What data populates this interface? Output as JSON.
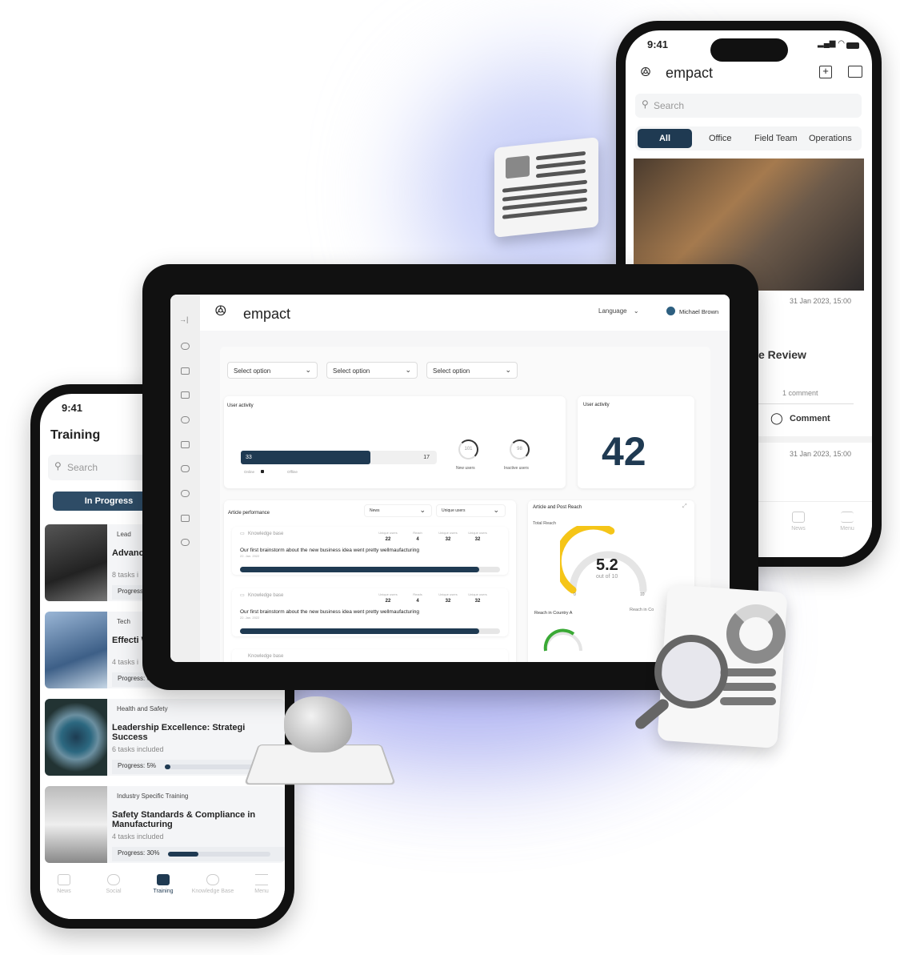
{
  "right_phone": {
    "time": "9:41",
    "brand": "empact",
    "search_placeholder": "Search",
    "tabs": [
      "All",
      "Office",
      "Field Team",
      "Operations"
    ],
    "post1_date": "31 Jan 2023, 15:00",
    "post1_title": "e Review",
    "post1_comments": "1 comment",
    "comment_label": "Comment",
    "post2_date": "31 Jan 2023, 15:00",
    "nav": [
      "News",
      "Menu"
    ]
  },
  "tablet": {
    "brand": "empact",
    "language_label": "Language",
    "user_name": "Michael Brown",
    "filters": [
      "Select option",
      "Select option",
      "Select option"
    ],
    "user_activity": {
      "title": "User activity",
      "online": 33,
      "offline": 17,
      "online_label": "Online",
      "offline_label": "Offline",
      "new_users": 101,
      "new_users_label": "New users",
      "inactive_users": 98,
      "inactive_users_label": "Inactive users"
    },
    "user_activity_total": {
      "title": "User activity",
      "value": "42"
    },
    "article_performance": {
      "title": "Article performance",
      "filter1": "News",
      "filter2": "Unique users",
      "items": [
        {
          "category": "Knowledge base",
          "title": "Our first brainstorm about the new business idea went pretty wellmaufacturing",
          "date": "22. Jan. 2022",
          "stats": [
            {
              "label": "Unique users",
              "value": "22"
            },
            {
              "label": "Reach",
              "value": "4"
            },
            {
              "label": "Unique users",
              "value": "32"
            },
            {
              "label": "Unique users",
              "value": "32"
            }
          ],
          "progress": 0.92
        },
        {
          "category": "Knowledge base",
          "title": "Our first brainstorm about the new business idea went pretty wellmaufacturing",
          "date": "22. Jan. 2022",
          "stats": [
            {
              "label": "Unique users",
              "value": "22"
            },
            {
              "label": "Reads",
              "value": "4"
            },
            {
              "label": "Unique users",
              "value": "32"
            },
            {
              "label": "Unique users",
              "value": "32"
            }
          ],
          "progress": 0.92
        },
        {
          "category": "Knowledge base"
        }
      ]
    },
    "reach": {
      "title": "Article and Post Reach",
      "total_label": "Total Reach",
      "value": "5.2",
      "out_of": "out of 10",
      "min": "0",
      "max": "10",
      "fraction": 0.52,
      "country_a_label": "Reach in Country A",
      "country_b_label": "Reach in Co",
      "gauge_color": "#f5c518",
      "country_a_color": "#3aa935"
    }
  },
  "left_phone": {
    "time": "9:41",
    "title": "Training",
    "search_placeholder": "Search",
    "tab_active": "In Progress",
    "courses": [
      {
        "tag": "Lead",
        "title": "Advanc Manag",
        "tasks": "8 tasks i",
        "progress_label": "Progress"
      },
      {
        "tag": "Tech",
        "title": "Effecti Workpl",
        "tasks": "4 tasks i",
        "progress_label": "Progress:  6"
      },
      {
        "tag": "Health and Safety",
        "title": "Leadership Excellence: Strategi Success",
        "tasks": "6 tasks included",
        "progress_label": "Progress:  5%",
        "progress": 0.05
      },
      {
        "tag": "Industry Specific Training",
        "title": "Safety Standards & Compliance in Manufacturing",
        "tasks": "4 tasks included",
        "progress_label": "Progress:  30%",
        "progress": 0.3
      }
    ],
    "nav": [
      "News",
      "Social",
      "Training",
      "Knowledge Base",
      "Menu"
    ],
    "nav_active": "Training"
  },
  "colors": {
    "primary": "#1f3a52",
    "glow": "#7a80e8"
  }
}
